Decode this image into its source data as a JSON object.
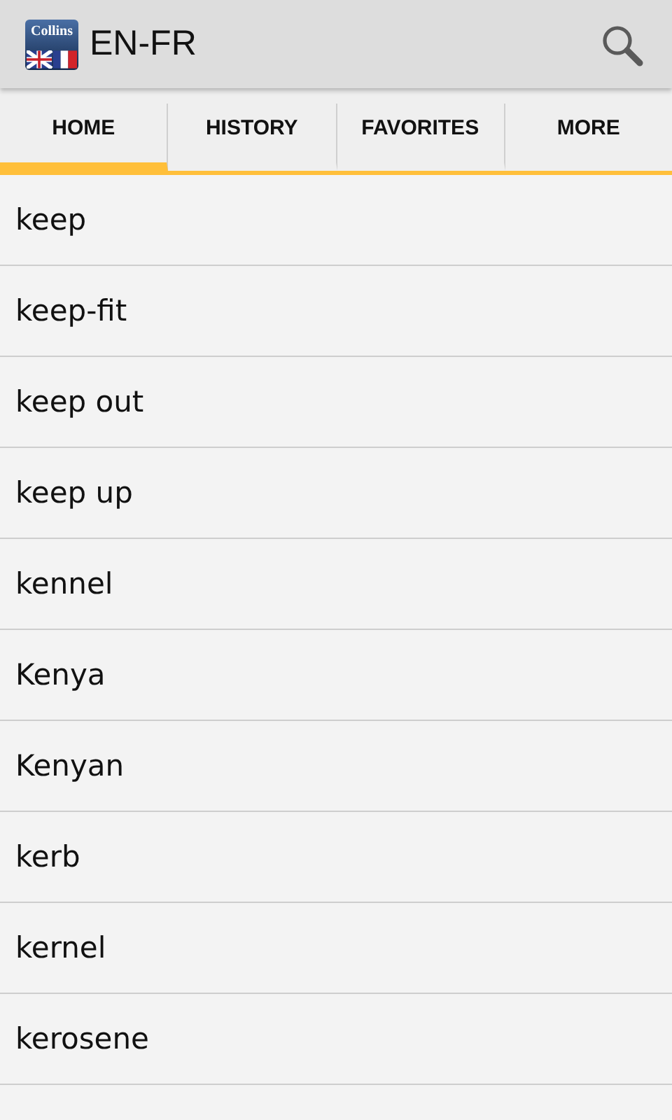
{
  "app_bar": {
    "logo_text": "Collins",
    "title": "EN-FR"
  },
  "tabs": [
    {
      "label": "HOME",
      "selected": true
    },
    {
      "label": "HISTORY",
      "selected": false
    },
    {
      "label": "FAVORITES",
      "selected": false
    },
    {
      "label": "MORE",
      "selected": false
    }
  ],
  "words": [
    "keep",
    "keep-fit",
    "keep out",
    "keep up",
    "kennel",
    "Kenya",
    "Kenyan",
    "kerb",
    "kernel",
    "kerosene"
  ]
}
